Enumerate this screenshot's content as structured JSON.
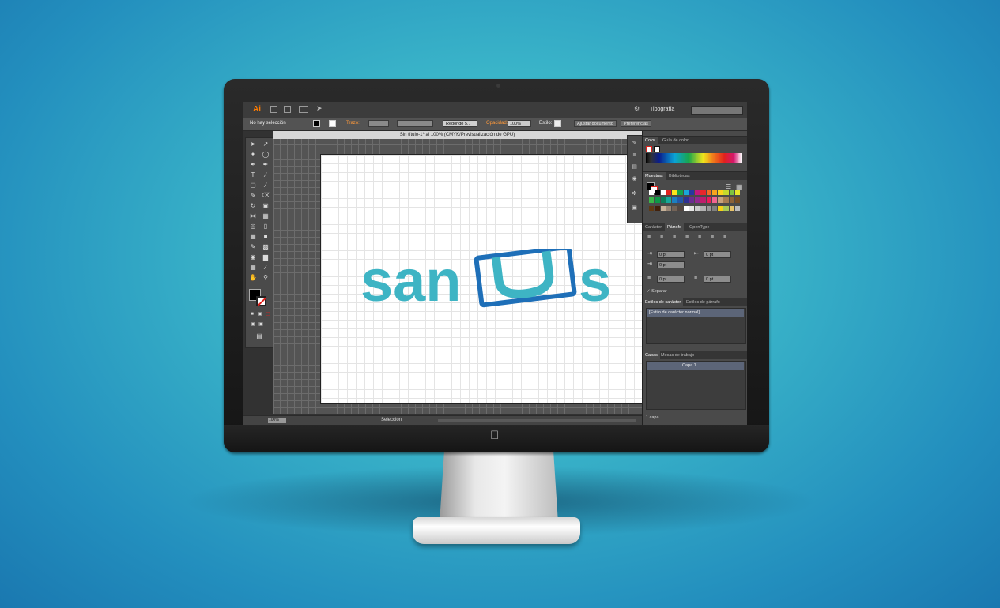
{
  "app": {
    "logo_text": "Ai",
    "workspace": "Tipografía"
  },
  "control_bar": {
    "selection": "No hay selección",
    "stroke_label": "Trazo:",
    "brush": "Redondo 5...",
    "opacity_label": "Opacidad:",
    "opacity_value": "100%",
    "style_label": "Estilo:",
    "doc_setup_button": "Ajustar documento",
    "prefs_button": "Preferencias"
  },
  "document": {
    "tab_title": "Sin título-1* al 100% (CMYK/Previsualización de GPU)"
  },
  "artwork": {
    "logo_text": "sanus",
    "primary_color": "#3eb4c4",
    "frame_color": "#1e6fb8"
  },
  "status_bar": {
    "zoom": "100%",
    "tool": "Selección"
  },
  "panels": {
    "color": {
      "tabs": [
        "Color",
        "Guía de color"
      ]
    },
    "swatches": {
      "tabs": [
        "Muestras",
        "Bibliotecas"
      ]
    },
    "paragraph": {
      "tabs": [
        "Carácter",
        "Párrafo",
        "OpenType"
      ],
      "left_indent": "0 pt",
      "right_indent": "0 pt",
      "first_indent": "0 pt",
      "space_before": "0 pt",
      "space_after": "0 pt",
      "hyphenate_label": "Separar"
    },
    "char_styles": {
      "tabs": [
        "Estilos de carácter",
        "Estilos de párrafo"
      ],
      "items": [
        "[Estilo de carácter normal]"
      ]
    },
    "layers": {
      "tabs": [
        "Capas",
        "Mesas de trabajo"
      ],
      "items": [
        "Capa 1"
      ],
      "footer": "1 capa"
    }
  }
}
